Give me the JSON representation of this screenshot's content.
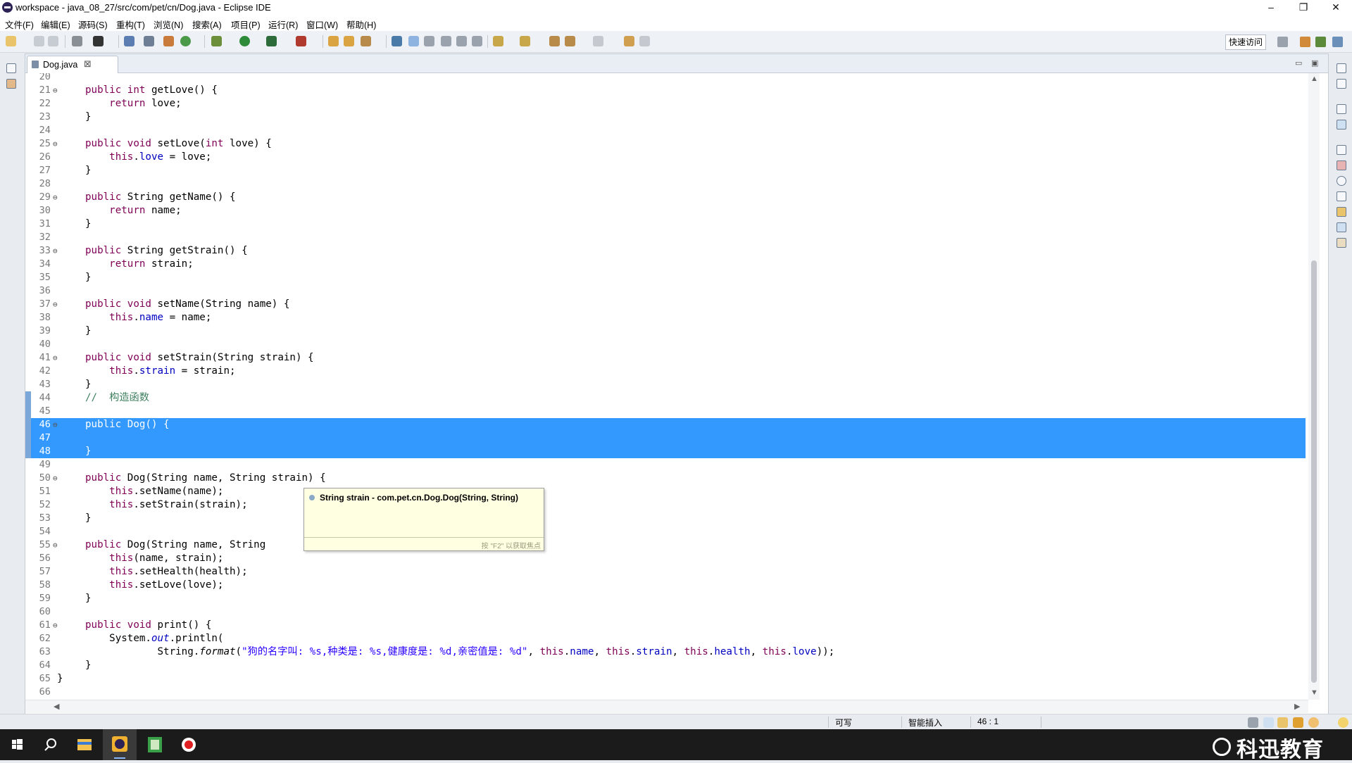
{
  "window": {
    "title": "workspace - java_08_27/src/com/pet/cn/Dog.java - Eclipse IDE",
    "minimize": "–",
    "restore": "❐",
    "close": "✕"
  },
  "menu": [
    "文件(F)",
    "编辑(E)",
    "源码(S)",
    "重构(T)",
    "浏览(N)",
    "搜索(A)",
    "项目(P)",
    "运行(R)",
    "窗口(W)",
    "帮助(H)"
  ],
  "toolbar": {
    "quick_access": "快速访问"
  },
  "editor": {
    "tab_label": "Dog.java",
    "tab_close": "⊠",
    "lines": [
      {
        "n": "20",
        "t": ""
      },
      {
        "n": "21",
        "t": "public int getLove() {",
        "f": true
      },
      {
        "n": "22",
        "t": "    return love;"
      },
      {
        "n": "23",
        "t": "}"
      },
      {
        "n": "24",
        "t": ""
      },
      {
        "n": "25",
        "t": "public void setLove(int love) {",
        "f": true
      },
      {
        "n": "26",
        "t": "    this.love = love;"
      },
      {
        "n": "27",
        "t": "}"
      },
      {
        "n": "28",
        "t": ""
      },
      {
        "n": "29",
        "t": "public String getName() {",
        "f": true
      },
      {
        "n": "30",
        "t": "    return name;"
      },
      {
        "n": "31",
        "t": "}"
      },
      {
        "n": "32",
        "t": ""
      },
      {
        "n": "33",
        "t": "public String getStrain() {",
        "f": true
      },
      {
        "n": "34",
        "t": "    return strain;"
      },
      {
        "n": "35",
        "t": "}"
      },
      {
        "n": "36",
        "t": ""
      },
      {
        "n": "37",
        "t": "public void setName(String name) {",
        "f": true
      },
      {
        "n": "38",
        "t": "    this.name = name;"
      },
      {
        "n": "39",
        "t": "}"
      },
      {
        "n": "40",
        "t": ""
      },
      {
        "n": "41",
        "t": "public void setStrain(String strain) {",
        "f": true
      },
      {
        "n": "42",
        "t": "    this.strain = strain;"
      },
      {
        "n": "43",
        "t": "}"
      },
      {
        "n": "44",
        "t": "//  构造函数"
      },
      {
        "n": "45",
        "t": ""
      },
      {
        "n": "46",
        "t": "public Dog() {",
        "f": true,
        "sel": true
      },
      {
        "n": "47",
        "t": "",
        "sel": true
      },
      {
        "n": "48",
        "t": "}",
        "sel": true
      },
      {
        "n": "49",
        "t": ""
      },
      {
        "n": "50",
        "t": "public Dog(String name, String strain) {",
        "f": true
      },
      {
        "n": "51",
        "t": "    this.setName(name);"
      },
      {
        "n": "52",
        "t": "    this.setStrain(strain);"
      },
      {
        "n": "53",
        "t": "}"
      },
      {
        "n": "54",
        "t": ""
      },
      {
        "n": "55",
        "t": "public Dog(String name, String",
        "f": true
      },
      {
        "n": "56",
        "t": "    this(name, strain);"
      },
      {
        "n": "57",
        "t": "    this.setHealth(health);"
      },
      {
        "n": "58",
        "t": "    this.setLove(love);"
      },
      {
        "n": "59",
        "t": "}"
      },
      {
        "n": "60",
        "t": ""
      },
      {
        "n": "61",
        "t": "public void print() {",
        "f": true
      },
      {
        "n": "62",
        "t": "    System.out.println("
      },
      {
        "n": "63",
        "t": "            String.format(\"狗的名字叫: %s,种类是: %s,健康度是: %d,亲密值是: %d\", this.name, this.strain, this.health, this.love));"
      },
      {
        "n": "64",
        "t": "}"
      },
      {
        "n": "65",
        "t": "}",
        "outer": true
      },
      {
        "n": "66",
        "t": ""
      }
    ]
  },
  "tooltip": {
    "signature": "String strain - com.pet.cn.Dog.Dog(String, String)",
    "footer": "按 \"F2\" 以获取焦点"
  },
  "status": {
    "writable": "可写",
    "insert_mode": "智能插入",
    "position": "46 : 1"
  },
  "brand": {
    "text": "科迅教育"
  },
  "colors": {
    "selection": "#3399ff",
    "keyword": "#7f0055",
    "field": "#0000c0",
    "string": "#2a00ff",
    "comment": "#3f7f5f"
  }
}
